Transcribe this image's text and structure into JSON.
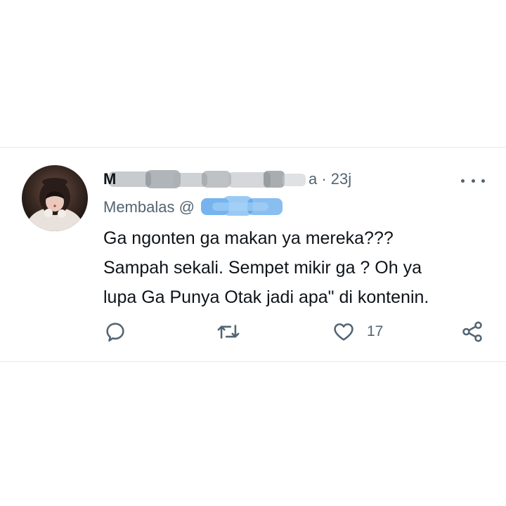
{
  "tweet": {
    "author_initial": "M",
    "handle_tail": "a · 23j",
    "replying_label": "Membalas @",
    "body_lines": [
      "Ga ngonten ga makan ya mereka???",
      "Sampah sekali. Sempet mikir ga ? Oh ya",
      "lupa Ga Punya Otak jadi apa\" di kontenin."
    ],
    "like_count": "17"
  },
  "icons": {
    "reply": "reply-icon",
    "retweet": "retweet-icon",
    "like": "heart-icon",
    "share": "share-icon",
    "more": "more-icon"
  },
  "colors": {
    "text": "#0f1419",
    "secondary": "#536471",
    "mention_blur": "#4a9be8",
    "divider": "#e6e9ec"
  }
}
